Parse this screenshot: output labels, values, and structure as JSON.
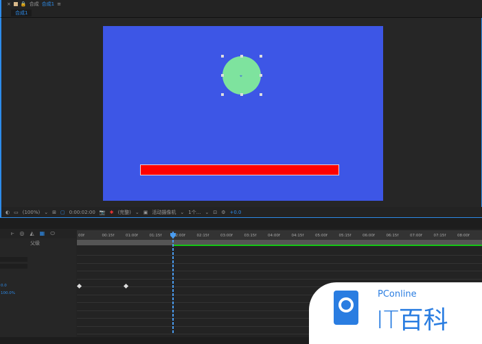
{
  "panel": {
    "title": "合成",
    "comp_name": "合成1",
    "tab": "合成1"
  },
  "viewer_toolbar": {
    "zoom": "(100%)",
    "timecode": "0:00:02:00",
    "resolution": "(完整)",
    "camera": "活动摄像机",
    "views": "1个...",
    "exposure": "+0.0"
  },
  "timeline": {
    "parent_label": "父级",
    "ticks": [
      "00f",
      "00:15f",
      "01:00f",
      "01:15f",
      "02:00f",
      "02:15f",
      "03:00f",
      "03:15f",
      "04:00f",
      "04:15f",
      "05:00f",
      "05:15f",
      "06:00f",
      "06:15f",
      "07:00f",
      "07:15f",
      "08:00f"
    ],
    "prop_value1": "0.0",
    "prop_value2": "100.0%"
  },
  "colors": {
    "background": "#3d56e6",
    "circle": "#7ee39e",
    "bar": "#ff0000",
    "accent": "#2d8ceb"
  },
  "watermark": {
    "brand": "PConline",
    "text": "IT百科"
  }
}
